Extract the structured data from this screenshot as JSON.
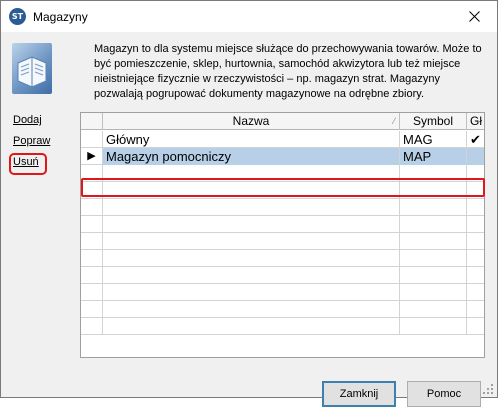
{
  "window": {
    "title": "Magazyny",
    "app_icon_text": "ST",
    "close_icon": "close-icon"
  },
  "description": "Magazyn to dla systemu miejsce służące do przechowywania towarów. Może to być pomieszczenie, sklep, hurtownia, samochód akwizytora lub też miejsce nieistniejące fizycznie w rzeczywistości – np. magazyn strat. Magazyny pozwalają pogrupować dokumenty magazynowe na odrębne zbiory.",
  "side_links": [
    "Dodaj",
    "Popraw",
    "Usuń"
  ],
  "table": {
    "columns": [
      "Nazwa",
      "Symbol",
      "Gł"
    ],
    "rows": [
      {
        "name": "Główny",
        "symbol": "MAG",
        "main": "✔",
        "selected": false,
        "indicator": ""
      },
      {
        "name": "Magazyn pomocniczy",
        "symbol": "MAP",
        "main": "",
        "selected": true,
        "indicator": "▶"
      }
    ],
    "empty_rows": 10
  },
  "buttons": {
    "close": "Zamknij",
    "help": "Pomoc"
  },
  "colors": {
    "highlight": "#e0161a",
    "selection": "#b7d0e8"
  }
}
